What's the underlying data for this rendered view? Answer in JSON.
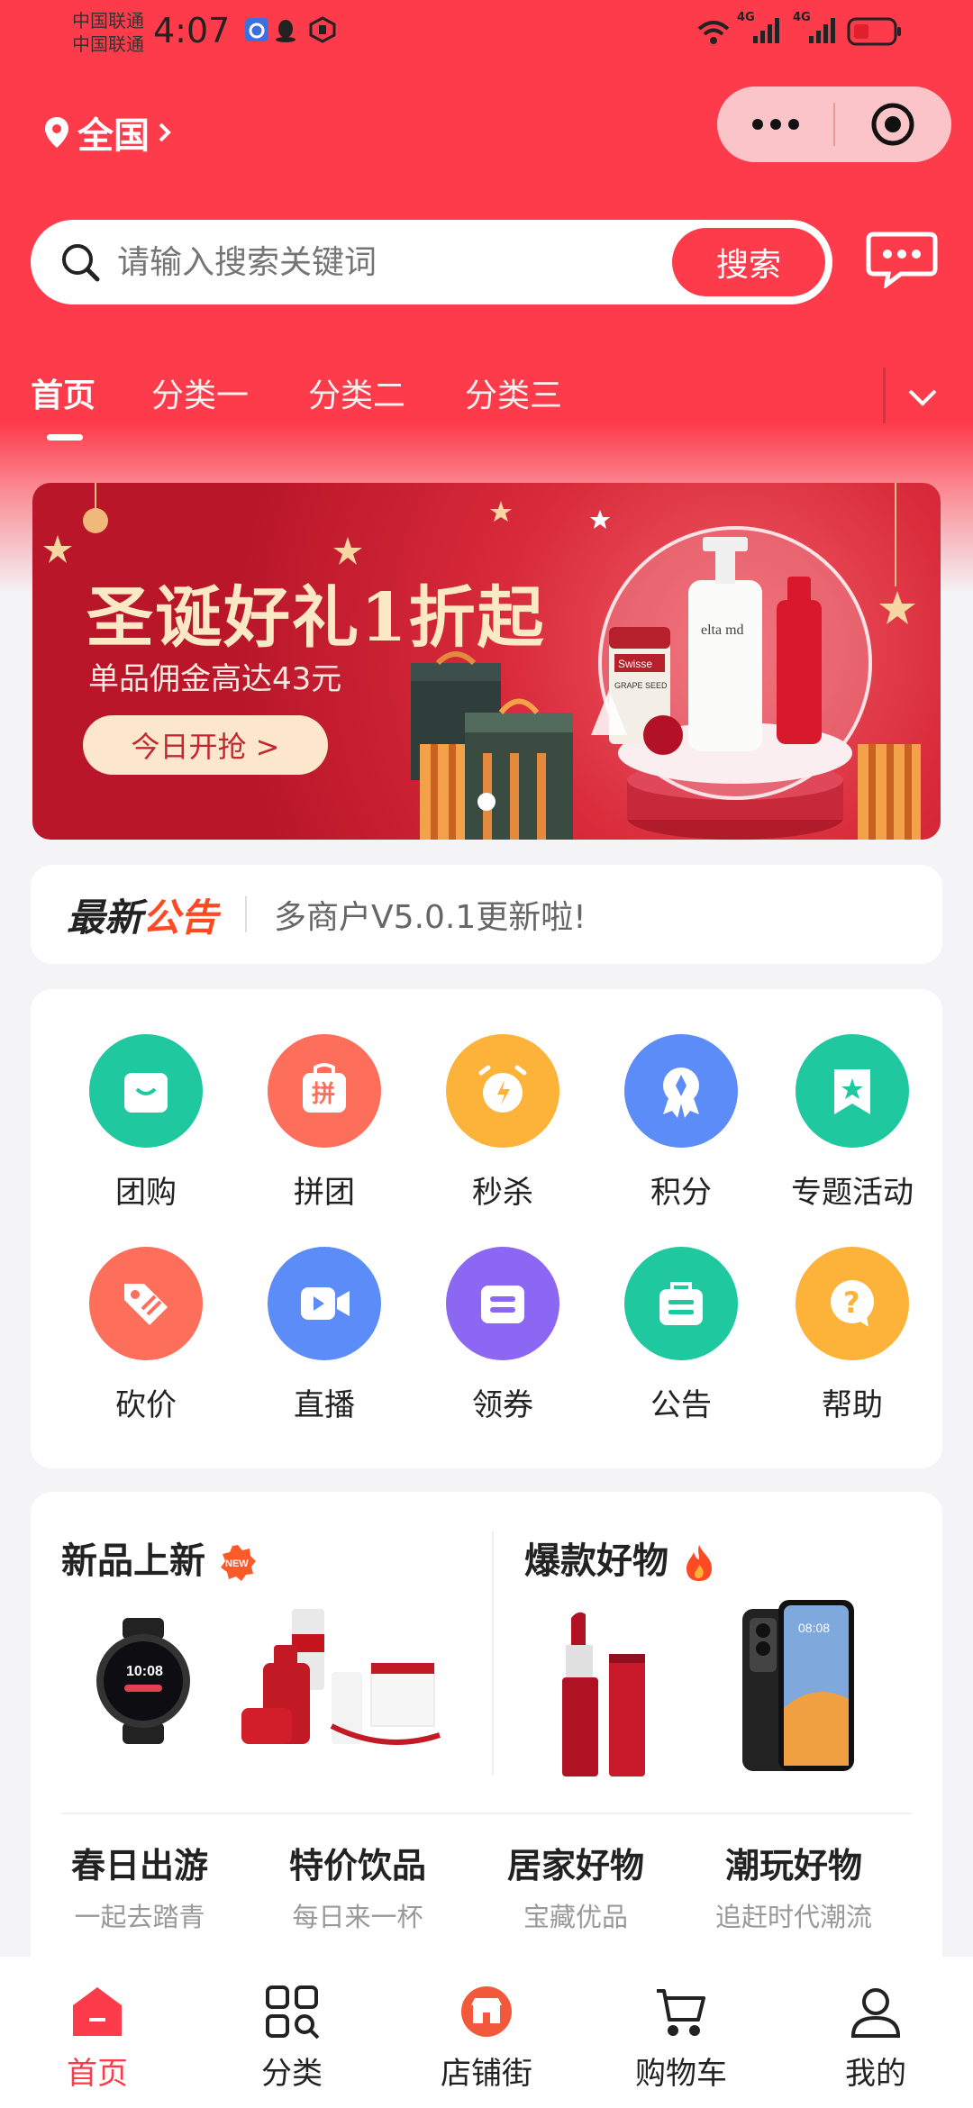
{
  "status_bar": {
    "carrier_1": "中国联通",
    "carrier_2": "中国联通",
    "time": "4:07",
    "signal_label_1": "4G",
    "signal_label_2": "4G"
  },
  "header": {
    "location": "全国",
    "search": {
      "placeholder": "请输入搜索关键词",
      "button": "搜索"
    },
    "tabs": [
      {
        "label": "首页",
        "active": true
      },
      {
        "label": "分类一",
        "active": false
      },
      {
        "label": "分类二",
        "active": false
      },
      {
        "label": "分类三",
        "active": false
      }
    ]
  },
  "banner": {
    "title": "圣诞好礼1折起",
    "subtitle": "单品佣金高达43元",
    "button": "今日开抢 >",
    "product_label_1": "Swisse",
    "product_label_2": "GRAPE SEED",
    "product_label_3": "elta md",
    "carousel_index": 1,
    "carousel_count": 1
  },
  "notice": {
    "title_part1": "最新",
    "title_part2": "公告",
    "text": "多商户V5.0.1更新啦!"
  },
  "quick_menu": [
    {
      "label": "团购",
      "icon": "shopping-bag-icon",
      "color": "#1fc89e"
    },
    {
      "label": "拼团",
      "icon": "group-buy-icon",
      "color": "#fd6e5b"
    },
    {
      "label": "秒杀",
      "icon": "alarm-clock-icon",
      "color": "#fdb23a"
    },
    {
      "label": "积分",
      "icon": "medal-icon",
      "color": "#5b8cf7"
    },
    {
      "label": "专题活动",
      "icon": "bookmark-star-icon",
      "color": "#1fc89e"
    },
    {
      "label": "砍价",
      "icon": "price-tag-icon",
      "color": "#fd6e5b"
    },
    {
      "label": "直播",
      "icon": "video-icon",
      "color": "#5b8cf7"
    },
    {
      "label": "领券",
      "icon": "coupon-icon",
      "color": "#8c67f3"
    },
    {
      "label": "公告",
      "icon": "notice-board-icon",
      "color": "#1fc89e"
    },
    {
      "label": "帮助",
      "icon": "question-icon",
      "color": "#fdb23a"
    }
  ],
  "promo": {
    "left_title": "新品上新",
    "left_badge": "NEW",
    "right_title": "爆款好物",
    "watch_time": "10:08",
    "phone_time": "08:08",
    "categories": [
      {
        "title": "春日出游",
        "subtitle": "一起去踏青"
      },
      {
        "title": "特价饮品",
        "subtitle": "每日来一杯"
      },
      {
        "title": "居家好物",
        "subtitle": "宝藏优品"
      },
      {
        "title": "潮玩好物",
        "subtitle": "追赶时代潮流"
      }
    ]
  },
  "tabbar": [
    {
      "label": "首页",
      "icon": "home-icon",
      "active": true
    },
    {
      "label": "分类",
      "icon": "category-grid-icon",
      "active": false
    },
    {
      "label": "店铺街",
      "icon": "store-icon",
      "active": false
    },
    {
      "label": "购物车",
      "icon": "cart-icon",
      "active": false
    },
    {
      "label": "我的",
      "icon": "user-icon",
      "active": false
    }
  ],
  "colors": {
    "brand": "#fd3b4b",
    "background": "#f4f4f6",
    "notice_accent": "#fd4a24"
  }
}
